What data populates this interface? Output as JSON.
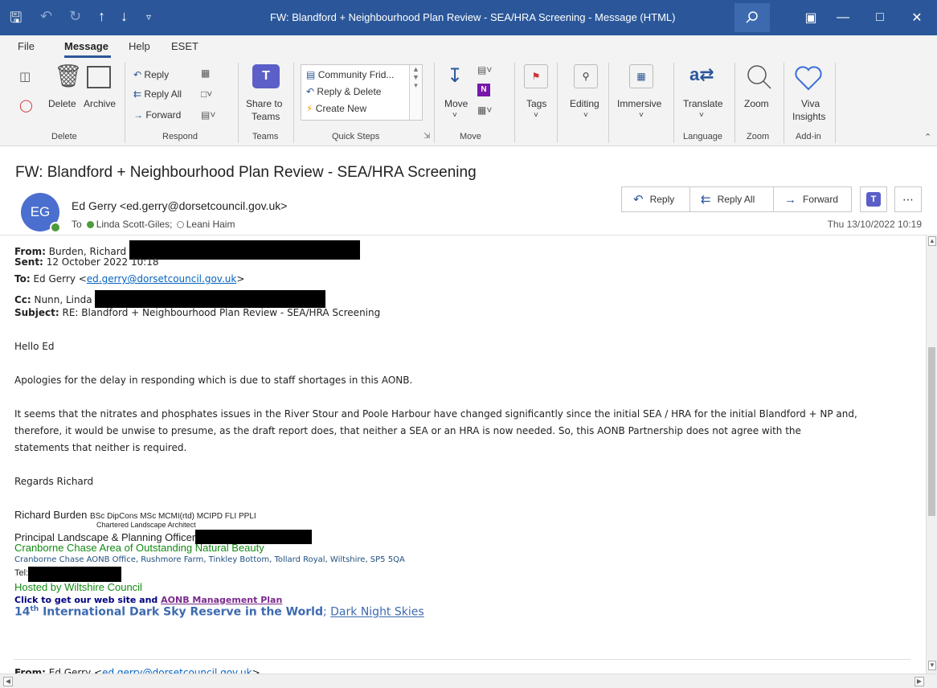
{
  "window": {
    "title": "FW: Blandford + Neighbourhood Plan Review - SEA/HRA Screening  -  Message (HTML)"
  },
  "menu": {
    "items": [
      "File",
      "Message",
      "Help",
      "ESET"
    ]
  },
  "ribbon": {
    "delete": {
      "delete_label": "Delete",
      "archive_label": "Archive",
      "group_label": "Delete"
    },
    "respond": {
      "reply": "Reply",
      "reply_all": "Reply All",
      "forward": "Forward",
      "group_label": "Respond"
    },
    "teams": {
      "share_line1": "Share to",
      "share_line2": "Teams",
      "group_label": "Teams"
    },
    "quick_steps": {
      "items": [
        "Community Frid...",
        "Reply & Delete",
        "Create New"
      ],
      "group_label": "Quick Steps"
    },
    "move": {
      "move_label": "Move",
      "group_label": "Move"
    },
    "tags": {
      "label": "Tags"
    },
    "editing": {
      "label": "Editing"
    },
    "immersive": {
      "label": "Immersive"
    },
    "language": {
      "translate_label": "Translate",
      "group_label": "Language"
    },
    "zoom": {
      "zoom_label": "Zoom",
      "group_label": "Zoom"
    },
    "addin": {
      "viva_line1": "Viva",
      "viva_line2": "Insights",
      "group_label": "Add-in"
    }
  },
  "message": {
    "subject": "FW: Blandford + Neighbourhood Plan Review - SEA/HRA Screening",
    "avatar_initials": "EG",
    "sender": "Ed Gerry <ed.gerry@dorsetcouncil.gov.uk>",
    "to_label": "To",
    "recipient1": "Linda Scott-Giles;",
    "recipient2": "Leani Haim",
    "date": "Thu 13/10/2022 10:19",
    "actions": {
      "reply": "Reply",
      "reply_all": "Reply All",
      "forward": "Forward"
    }
  },
  "email": {
    "from_label": "From:",
    "from_value": "Burden, Richard",
    "sent_label": "Sent:",
    "sent_value": "12 October 2022 10:18",
    "to_label": "To:",
    "to_prefix": "Ed Gerry <",
    "to_link": "ed.gerry@dorsetcouncil.gov.uk",
    "to_suffix": ">",
    "cc_label": "Cc:",
    "cc_value": "Nunn, Linda",
    "subject_label": "Subject:",
    "subject_value": "RE: Blandford + Neighbourhood Plan Review - SEA/HRA Screening",
    "greeting": "Hello Ed",
    "para1": "Apologies for the delay in responding which is due to staff shortages in this AONB.",
    "para2_line1": "It seems that the nitrates and phosphates issues in the River Stour and Poole Harbour have changed significantly since the initial SEA / HRA for the initial Blandford + NP and,",
    "para2_line2": "therefore, it would be unwise to presume, as the draft report does, that neither a SEA or an HRA is now needed.  So, this AONB Partnership does not agree with the",
    "para2_line3": "statements that neither is required.",
    "signoff": "Regards  Richard",
    "sig_name": "Richard Burden",
    "sig_quals": "BSc DipCons MSc MCMI(rtd) MCIPD FLI PPLI",
    "sig_role": "Chartered Landscape Architect",
    "sig_title": "Principal Landscape & Planning Officer",
    "sig_org": "Cranborne Chase Area of Outstanding Natural Beauty",
    "sig_address": "Cranborne Chase AONB Office, Rushmore Farm, Tinkley Bottom, Tollard Royal, Wiltshire, SP5 5QA",
    "sig_tel": "Tel:",
    "sig_hosted": "Hosted by Wiltshire Council",
    "sig_click": "Click to get our web site and ",
    "sig_plan_link": "AONB Management Plan",
    "sig_dark_num": "14",
    "sig_dark_sup": "th",
    "sig_dark_text": " International Dark Sky Reserve in the World",
    "sig_dark_sep": "; ",
    "sig_dark_link": "Dark Night Skies",
    "next_from_label": "From:",
    "next_from_prefix": "Ed Gerry <",
    "next_from_link": "ed.gerry@dorsetcouncil.gov.uk",
    "next_from_suffix": ">"
  },
  "colors": {
    "titlebar": "#2b579a",
    "ribbon_bg": "#f3f3f3",
    "link": "#0563c1",
    "sig_green": "#138a13",
    "sig_navy": "#1f4f7f",
    "avatar": "#4a6fcf"
  }
}
